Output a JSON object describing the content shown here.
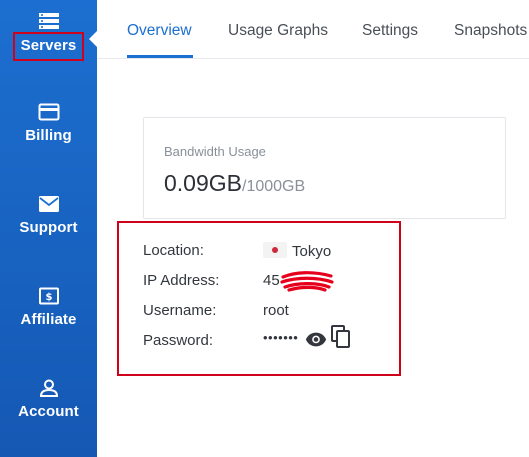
{
  "sidebar": {
    "items": [
      {
        "label": "Servers",
        "icon": "servers-icon",
        "active": true
      },
      {
        "label": "Billing",
        "icon": "billing-icon"
      },
      {
        "label": "Support",
        "icon": "support-icon"
      },
      {
        "label": "Affiliate",
        "icon": "affiliate-icon"
      },
      {
        "label": "Account",
        "icon": "account-icon"
      }
    ]
  },
  "tabs": [
    {
      "label": "Overview",
      "active": true
    },
    {
      "label": "Usage Graphs"
    },
    {
      "label": "Settings"
    },
    {
      "label": "Snapshots"
    }
  ],
  "bandwidth": {
    "title": "Bandwidth Usage",
    "used": "0.09GB",
    "total": "/1000GB"
  },
  "info": {
    "location_label": "Location:",
    "location_value": "Tokyo",
    "ip_label": "IP Address:",
    "ip_value": "45",
    "username_label": "Username:",
    "username_value": "root",
    "password_label": "Password:",
    "password_value": "•••••••"
  },
  "colors": {
    "sidebar": "#1c6fd0",
    "accent": "#1b6fd0",
    "highlight": "#d0021b"
  }
}
